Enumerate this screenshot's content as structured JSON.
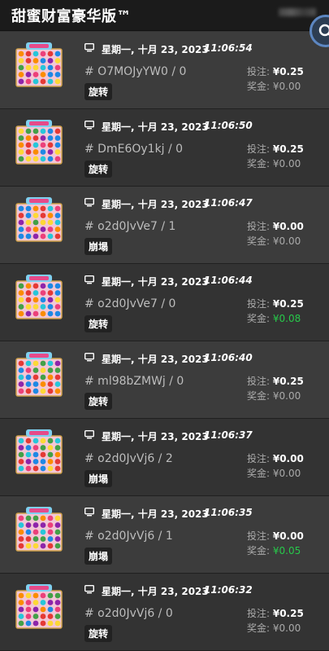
{
  "header": {
    "title": "甜蜜财富豪华版™"
  },
  "labels": {
    "bet": "投注: ",
    "win": "奖金: "
  },
  "rows": [
    {
      "date": "星期一, 十月 23, 2023",
      "time": "11:06:54",
      "id": "# O7MOJyYW0 / 0",
      "tag": "旋转",
      "bet": "¥0.25",
      "win": "¥0.00",
      "win_positive": false
    },
    {
      "date": "星期一, 十月 23, 2023",
      "time": "11:06:50",
      "id": "# DmE6Oy1kj / 0",
      "tag": "旋转",
      "bet": "¥0.25",
      "win": "¥0.00",
      "win_positive": false
    },
    {
      "date": "星期一, 十月 23, 2023",
      "time": "11:06:47",
      "id": "# o2d0JvVe7 / 1",
      "tag": "崩塌",
      "bet": "¥0.00",
      "win": "¥0.00",
      "win_positive": false
    },
    {
      "date": "星期一, 十月 23, 2023",
      "time": "11:06:44",
      "id": "# o2d0JvVe7 / 0",
      "tag": "旋转",
      "bet": "¥0.25",
      "win": "¥0.08",
      "win_positive": true
    },
    {
      "date": "星期一, 十月 23, 2023",
      "time": "11:06:40",
      "id": "# ml98bZMWj / 0",
      "tag": "旋转",
      "bet": "¥0.25",
      "win": "¥0.00",
      "win_positive": false
    },
    {
      "date": "星期一, 十月 23, 2023",
      "time": "11:06:37",
      "id": "# o2d0JvVj6 / 2",
      "tag": "崩塌",
      "bet": "¥0.00",
      "win": "¥0.00",
      "win_positive": false
    },
    {
      "date": "星期一, 十月 23, 2023",
      "time": "11:06:35",
      "id": "# o2d0JvVj6 / 1",
      "tag": "崩塌",
      "bet": "¥0.00",
      "win": "¥0.05",
      "win_positive": true
    },
    {
      "date": "星期一, 十月 23, 2023",
      "time": "11:06:32",
      "id": "# o2d0JvVj6 / 0",
      "tag": "旋转",
      "bet": "¥0.25",
      "win": "¥0.00",
      "win_positive": true
    }
  ],
  "colors": {
    "win_positive": "#27c94a",
    "row_alt": "#3c3c3c",
    "row_norm": "#333333",
    "header_bg": "#1b1b1b",
    "search_ring": "#5d87c2"
  },
  "icons": {
    "search": "search-icon",
    "monitor": "monitor-icon",
    "thumbnail": "game-thumbnail-icon"
  }
}
